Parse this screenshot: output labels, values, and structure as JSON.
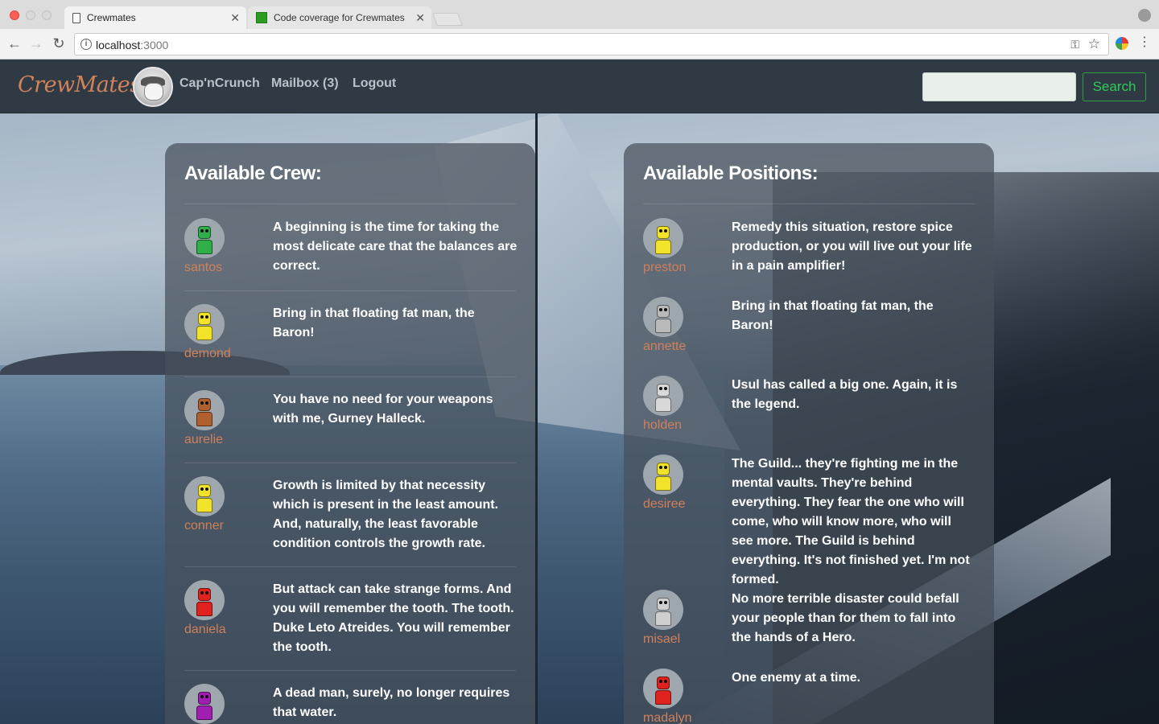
{
  "browser": {
    "tabs": [
      {
        "title": "Crewmates",
        "active": true
      },
      {
        "title": "Code coverage for Crewmates",
        "active": false
      }
    ],
    "url_host": "localhost",
    "url_port": ":3000"
  },
  "nav": {
    "brand": "CrewMates",
    "username": "Cap'nCrunch",
    "mailbox": "Mailbox (3)",
    "logout": "Logout",
    "search_value": "",
    "search_button": "Search"
  },
  "crew": {
    "title": "Available Crew:",
    "items": [
      {
        "name": "santos",
        "color": "#2fae4a",
        "message": "A beginning is the time for taking the most delicate care that the balances are correct."
      },
      {
        "name": "demond",
        "color": "#f2e22a",
        "message": "Bring in that floating fat man, the Baron!"
      },
      {
        "name": "aurelie",
        "color": "#b0602e",
        "message": "You have no need for your weapons with me, Gurney Halleck."
      },
      {
        "name": "conner",
        "color": "#f2e22a",
        "message": "Growth is limited by that necessity which is present in the least amount. And, naturally, the least favorable condition controls the growth rate."
      },
      {
        "name": "daniela",
        "color": "#e0221e",
        "message": "But attack can take strange forms. And you will remember the tooth. The tooth. Duke Leto Atreides. You will remember the tooth."
      },
      {
        "name": "",
        "color": "#a01fb0",
        "message": "A dead man, surely, no longer requires that water."
      }
    ]
  },
  "positions": {
    "title": "Available Positions:",
    "items": [
      {
        "name": "preston",
        "color": "#f2e22a",
        "message": "Remedy this situation, restore spice production, or you will live out your life in a pain amplifier!"
      },
      {
        "name": "annette",
        "color": "#b9b9b9",
        "message": "Bring in that floating fat man, the Baron!"
      },
      {
        "name": "holden",
        "color": "#d8d8d8",
        "message": "Usul has called a big one. Again, it is the legend."
      },
      {
        "name": "desiree",
        "color": "#f2e22a",
        "message": "The Guild... they're fighting me in the mental vaults. They're behind everything. They fear the one who will come, who will know more, who will see more. The Guild is behind everything. It's not finished yet. I'm not formed."
      },
      {
        "name": "misael",
        "color": "#cfcfcf",
        "message": "No more terrible disaster could befall your people than for them to fall into the hands of a Hero."
      },
      {
        "name": "madalyn",
        "color": "#e0221e",
        "message": "One enemy at a time."
      }
    ]
  }
}
